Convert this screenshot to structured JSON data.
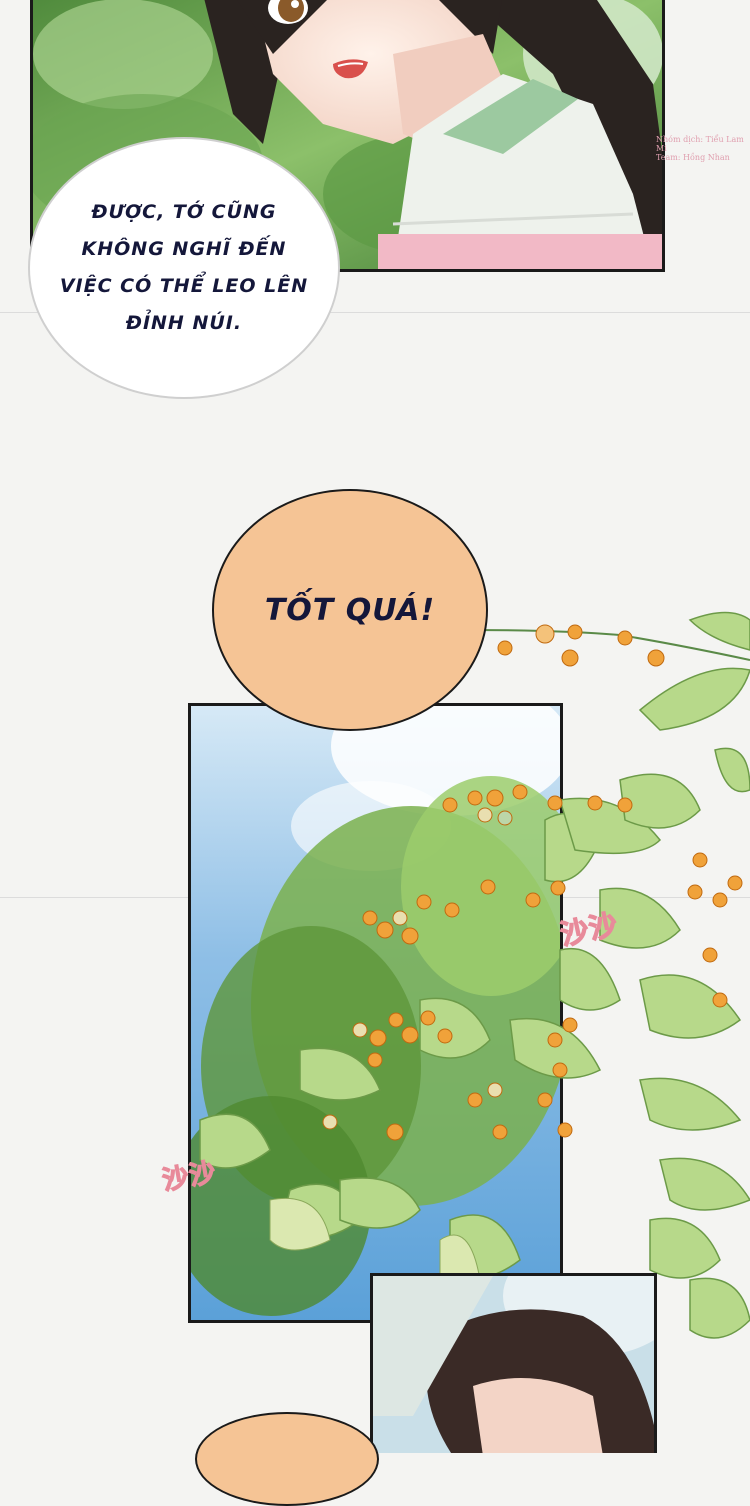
{
  "panels": {
    "top": {
      "scene": "girl smiling in green jacket, forest background"
    },
    "middle": {
      "scene": "sky with leafy branches and orange berries"
    },
    "bottom": {
      "scene": "girl with dark hair among leaves"
    }
  },
  "bubbles": {
    "first": {
      "text": "ĐƯỢC, TỚ CŨNG KHÔNG NGHĨ ĐẾN VIỆC CÓ THỂ LEO LÊN ĐỈNH NÚI."
    },
    "second": {
      "text": "TỐT QUÁ!"
    }
  },
  "sfx": {
    "rustle_1": "沙沙",
    "rustle_2": "沙沙"
  },
  "credit": {
    "line1": "Nhóm dịch: Tiểu Lam Mi",
    "line2": "Team: Hồng Nhan"
  },
  "colors": {
    "bubble_peach": "#f5c495",
    "bubble_white": "#ffffff",
    "ink": "#14173a",
    "frame": "#1a1a1a"
  }
}
